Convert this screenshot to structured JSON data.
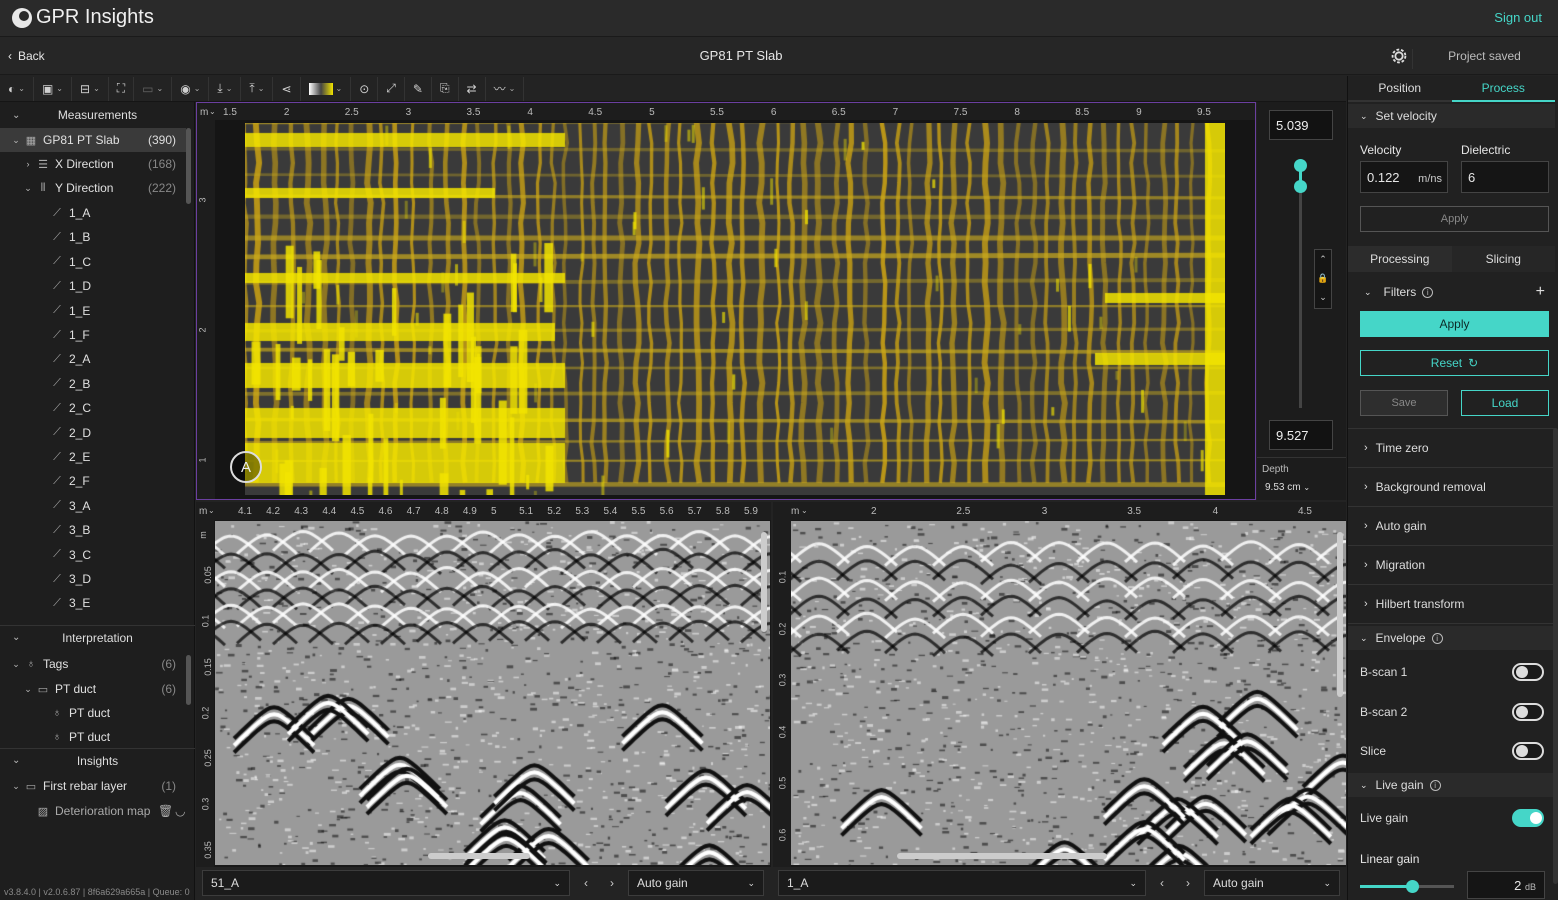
{
  "app": {
    "title": "GPR Insights",
    "sign_out": "Sign out"
  },
  "subbar": {
    "back": "Back",
    "project_title": "GP81 PT Slab",
    "status": "Project saved"
  },
  "toolbar": {
    "icons": [
      "logo-menu-icon",
      "layout-icon",
      "grid-view-icon",
      "focus-icon",
      "crop-icon",
      "eye-icon",
      "import-icon",
      "export-icon",
      "share-icon",
      "colormap-icon",
      "zoom-icon",
      "fullscreen-icon",
      "measure-icon",
      "annotate-icon",
      "sync-icon",
      "chart-icon"
    ]
  },
  "left": {
    "measurements_title": "Measurements",
    "project": {
      "label": "GP81 PT Slab",
      "count": "(390)"
    },
    "x_dir": {
      "label": "X Direction",
      "count": "(168)"
    },
    "y_dir": {
      "label": "Y Direction",
      "count": "(222)"
    },
    "scans": [
      "1_A",
      "1_B",
      "1_C",
      "1_D",
      "1_E",
      "1_F",
      "2_A",
      "2_B",
      "2_C",
      "2_D",
      "2_E",
      "2_F",
      "3_A",
      "3_B",
      "3_C",
      "3_D",
      "3_E"
    ],
    "interpretation_title": "Interpretation",
    "tags": {
      "label": "Tags",
      "count": "(6)"
    },
    "pt_duct_group": {
      "label": "PT duct",
      "count": "(6)"
    },
    "pt_items": [
      "PT duct",
      "PT duct"
    ],
    "insights_title": "Insights",
    "rebar_layer": {
      "label": "First rebar layer",
      "count": "(1)"
    },
    "deterioration": "Deterioration map",
    "version": "v3.8.4.0 | v2.0.6.87 | 8f6a629a665a | Queue: 0"
  },
  "cscan": {
    "x_unit": "m",
    "x_ticks": [
      "1.5",
      "2",
      "2.5",
      "3",
      "3.5",
      "4",
      "4.5",
      "5",
      "5.5",
      "6",
      "6.5",
      "7",
      "7.5",
      "8",
      "8.5",
      "9",
      "9.5"
    ],
    "y_ticks": [
      "3",
      "2",
      "1"
    ],
    "badge": "A"
  },
  "depth": {
    "top": "5.039",
    "bottom": "9.527",
    "label": "Depth",
    "value": "9.53 cm"
  },
  "bscan1": {
    "x_unit": "m",
    "x_ticks": [
      "4.1",
      "4.2",
      "4.3",
      "4.4",
      "4.5",
      "4.6",
      "4.7",
      "4.8",
      "4.9",
      "5",
      "5.1",
      "5.2",
      "5.3",
      "5.4",
      "5.5",
      "5.6",
      "5.7",
      "5.8",
      "5.9"
    ],
    "y_unit": "m",
    "y_ticks": [
      "0.05",
      "0.1",
      "0.15",
      "0.2",
      "0.25",
      "0.3",
      "0.35"
    ],
    "scan": "51_A",
    "gain": "Auto gain"
  },
  "bscan2": {
    "x_unit": "m",
    "x_ticks": [
      "2",
      "2.5",
      "3",
      "3.5",
      "4",
      "4.5"
    ],
    "y_ticks": [
      "0.1",
      "0.2",
      "0.3",
      "0.4",
      "0.5",
      "0.6"
    ],
    "scan": "1_A",
    "gain": "Auto gain"
  },
  "right": {
    "tab_position": "Position",
    "tab_process": "Process",
    "set_velocity": "Set velocity",
    "velocity_label": "Velocity",
    "velocity_value": "0.122",
    "velocity_unit": "m/ns",
    "dielectric_label": "Dielectric",
    "dielectric_value": "6",
    "apply": "Apply",
    "tab_processing": "Processing",
    "tab_slicing": "Slicing",
    "filters": "Filters",
    "filters_apply": "Apply",
    "reset": "Reset",
    "save": "Save",
    "load": "Load",
    "sections": [
      "Time zero",
      "Background removal",
      "Auto gain",
      "Migration",
      "Hilbert transform"
    ],
    "envelope": "Envelope",
    "bscan1": "B-scan 1",
    "bscan2": "B-scan 2",
    "slice": "Slice",
    "live_gain_title": "Live gain",
    "live_gain": "Live gain",
    "linear_gain": "Linear gain",
    "gain_value": "2",
    "gain_unit": "dB",
    "gain_level": 0.55
  },
  "colors": {
    "accent": "#45d6c8",
    "rebar_yellow": "#f2e400",
    "frame": "#6b3fa0"
  }
}
